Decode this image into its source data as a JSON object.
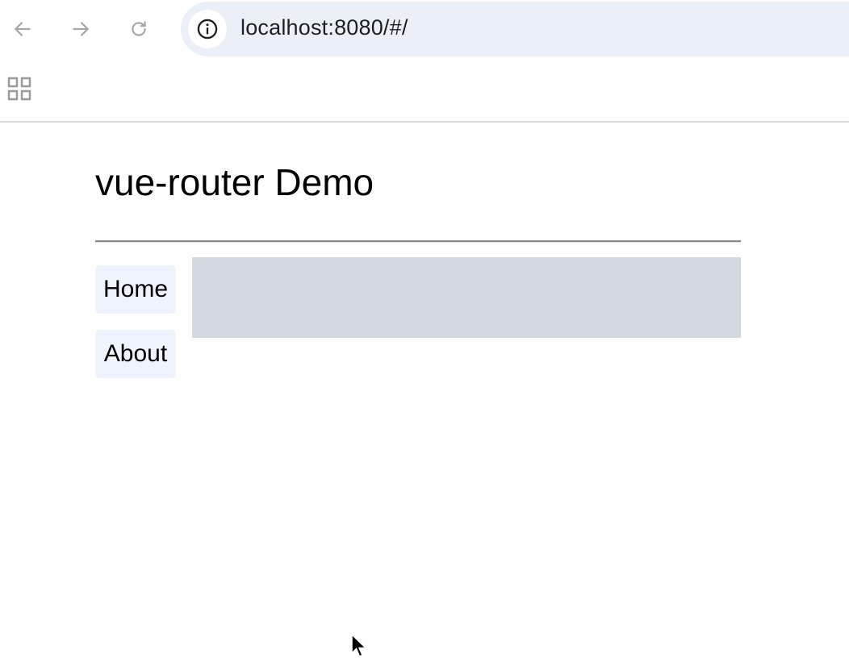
{
  "browser": {
    "url": "localhost:8080/#/",
    "icons": {
      "back": "arrow-left-icon",
      "forward": "arrow-right-icon",
      "reload": "reload-icon",
      "site_info": "info-icon",
      "apps": "apps-grid-icon"
    }
  },
  "page": {
    "title": "vue-router Demo",
    "nav": [
      {
        "label": "Home"
      },
      {
        "label": "About"
      }
    ]
  },
  "colors": {
    "omnibox_bg": "#eaeff8",
    "nav_link_bg": "#eef3fd",
    "router_view_bg": "#d3d9e1"
  }
}
